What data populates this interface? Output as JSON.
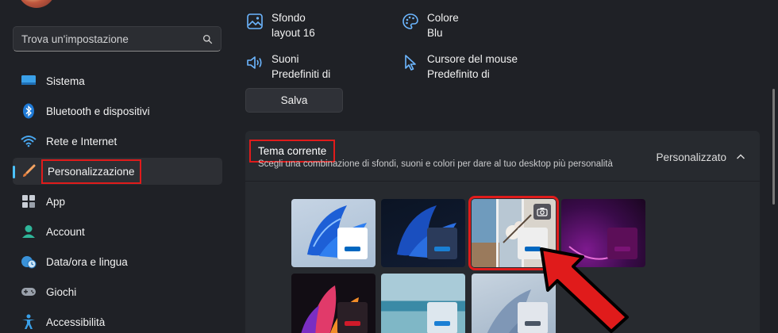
{
  "search": {
    "placeholder": "Trova un'impostazione"
  },
  "sidebar": {
    "items": [
      {
        "label": "Sistema",
        "icon": "monitor-icon"
      },
      {
        "label": "Bluetooth e dispositivi",
        "icon": "bluetooth-icon"
      },
      {
        "label": "Rete e Internet",
        "icon": "wifi-icon"
      },
      {
        "label": "Personalizzazione",
        "icon": "brush-icon",
        "active": true
      },
      {
        "label": "App",
        "icon": "apps-icon"
      },
      {
        "label": "Account",
        "icon": "user-icon"
      },
      {
        "label": "Data/ora e lingua",
        "icon": "globe-clock-icon"
      },
      {
        "label": "Giochi",
        "icon": "gamepad-icon"
      },
      {
        "label": "Accessibilità",
        "icon": "accessibility-icon"
      }
    ]
  },
  "properties": {
    "background": {
      "title": "Sfondo",
      "value": "layout 16"
    },
    "color": {
      "title": "Colore",
      "value": "Blu"
    },
    "sounds": {
      "title": "Suoni",
      "value": "Predefiniti di"
    },
    "cursor": {
      "title": "Cursore del mouse",
      "value": "Predefinito di"
    }
  },
  "save_label": "Salva",
  "theme": {
    "title": "Tema corrente",
    "subtitle": "Scegli una combinazione di sfondi, suoni e colori per dare al tuo desktop più personalità",
    "current_value": "Personalizzato"
  },
  "themes": [
    {
      "name": "windows-light",
      "swatch": "#ffffff",
      "accent": "#0067c0",
      "selected": false
    },
    {
      "name": "windows-dark",
      "swatch": "#2b3b5b",
      "accent": "#1a7fd4",
      "selected": false
    },
    {
      "name": "custom-blossom",
      "swatch": "#eeeeee",
      "accent": "#0067c0",
      "selected": true
    },
    {
      "name": "glow",
      "swatch": "#5c0e58",
      "accent": "#7a1475",
      "selected": false
    },
    {
      "name": "captured-motion",
      "swatch": "#2a1f26",
      "accent": "#d11a2a",
      "selected": false
    },
    {
      "name": "sunrise",
      "swatch": "#dde7ee",
      "accent": "#1a7fd4",
      "selected": false
    },
    {
      "name": "flow",
      "swatch": "#e2e6ec",
      "accent": "#4a5564",
      "selected": false
    }
  ],
  "colors": {
    "accent": "#4cc2ff",
    "highlight": "#e01b1b",
    "background": "#1f2126"
  }
}
